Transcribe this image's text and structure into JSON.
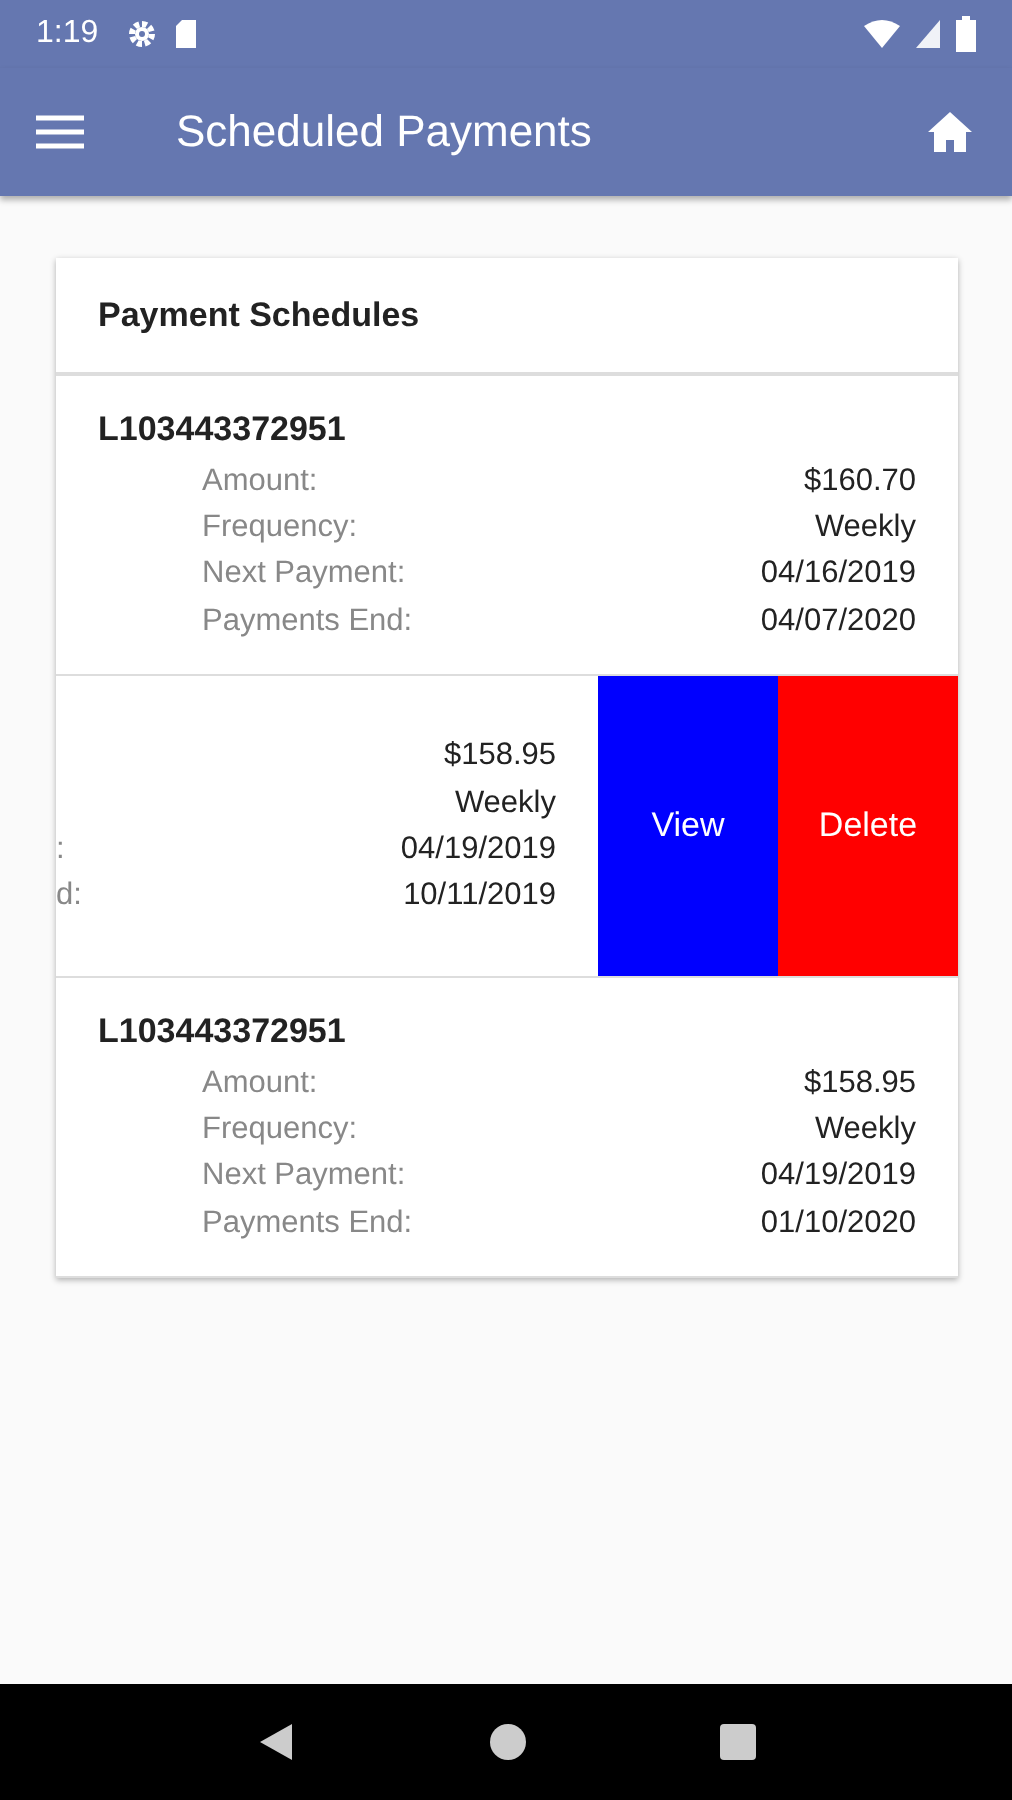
{
  "status_bar": {
    "time": "1:19"
  },
  "app_bar": {
    "title": "Scheduled Payments"
  },
  "card": {
    "title": "Payment Schedules",
    "schedules": [
      {
        "swiped": false,
        "loan": "L103443372951",
        "fields": [
          {
            "label": "Amount:",
            "value": "$160.70"
          },
          {
            "label": "Frequency:",
            "value": "Weekly"
          },
          {
            "label": "Next Payment:",
            "value": "04/16/2019"
          },
          {
            "label": "Payments End:",
            "value": "04/07/2020"
          }
        ]
      },
      {
        "swiped": true,
        "fields": [
          {
            "value": "$158.95"
          },
          {
            "value": "Weekly"
          },
          {
            "label": ":",
            "value": "04/19/2019"
          },
          {
            "label": "d:",
            "value": "10/11/2019"
          }
        ],
        "actions": [
          {
            "kind": "view",
            "label": "View"
          },
          {
            "kind": "delete",
            "label": "Delete"
          }
        ]
      },
      {
        "swiped": false,
        "loan": "L103443372951",
        "fields": [
          {
            "label": "Amount:",
            "value": "$158.95"
          },
          {
            "label": "Frequency:",
            "value": "Weekly"
          },
          {
            "label": "Next Payment:",
            "value": "04/19/2019"
          },
          {
            "label": "Payments End:",
            "value": "01/10/2020"
          }
        ]
      }
    ]
  }
}
